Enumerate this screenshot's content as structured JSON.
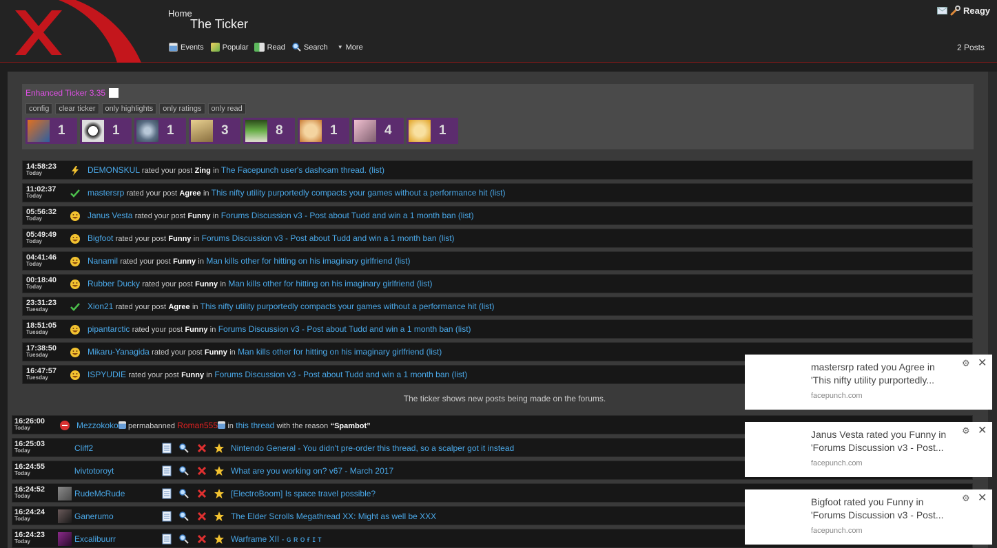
{
  "header": {
    "breadcrumb": "Home",
    "title": "The Ticker",
    "nav": [
      {
        "label": "Events",
        "icon": "calendar-icon"
      },
      {
        "label": "Popular",
        "icon": "popular-icon"
      },
      {
        "label": "Read",
        "icon": "read-icon"
      },
      {
        "label": "Search",
        "icon": "search-icon"
      },
      {
        "label": "More",
        "icon": "chevron-down-icon"
      }
    ],
    "username": "Reagy",
    "posts": "2 Posts"
  },
  "enhanced": {
    "title": "Enhanced Ticker 3.35",
    "buttons": [
      "config",
      "clear ticker",
      "only highlights",
      "only ratings",
      "only read"
    ],
    "avatars": [
      {
        "count": "1",
        "color": "#2f5fa0"
      },
      {
        "count": "1",
        "color": "#ddd"
      },
      {
        "count": "1",
        "color": "#7f93a8"
      },
      {
        "count": "3",
        "color": "#c9a860"
      },
      {
        "count": "8",
        "color": "#4c8a3a"
      },
      {
        "count": "1",
        "color": "#e0b060"
      },
      {
        "count": "4",
        "color": "#c08aa0"
      },
      {
        "count": "1",
        "color": "#e6b040"
      }
    ]
  },
  "ratings": [
    {
      "time": "14:58:23",
      "day": "Today",
      "icon": "zing",
      "user": "DEMONSKUL",
      "mid": "rated your post",
      "rating": "Zing",
      "in": "in",
      "thread": "The Facepunch user's dashcam thread.",
      "list": "(list)"
    },
    {
      "time": "11:02:37",
      "day": "Today",
      "icon": "agree",
      "user": "mastersrp",
      "mid": "rated your post",
      "rating": "Agree",
      "in": "in",
      "thread": "This nifty utility purportedly compacts your games without a performance hit",
      "list": "(list)"
    },
    {
      "time": "05:56:32",
      "day": "Today",
      "icon": "funny",
      "user": "Janus Vesta",
      "mid": "rated your post",
      "rating": "Funny",
      "in": "in",
      "thread": "Forums Discussion v3 - Post about Tudd and win a 1 month ban",
      "list": "(list)"
    },
    {
      "time": "05:49:49",
      "day": "Today",
      "icon": "funny",
      "user": "Bigfoot",
      "mid": "rated your post",
      "rating": "Funny",
      "in": "in",
      "thread": "Forums Discussion v3 - Post about Tudd and win a 1 month ban",
      "list": "(list)"
    },
    {
      "time": "04:41:46",
      "day": "Today",
      "icon": "funny",
      "user": "Nanamil",
      "mid": "rated your post",
      "rating": "Funny",
      "in": "in",
      "thread": "Man kills other for hitting on his imaginary girlfriend",
      "list": "(list)"
    },
    {
      "time": "00:18:40",
      "day": "Today",
      "icon": "funny",
      "user": "Rubber Ducky",
      "mid": "rated your post",
      "rating": "Funny",
      "in": "in",
      "thread": "Man kills other for hitting on his imaginary girlfriend",
      "list": "(list)"
    },
    {
      "time": "23:31:23",
      "day": "Tuesday",
      "icon": "agree",
      "user": "Xion21",
      "mid": "rated your post",
      "rating": "Agree",
      "in": "in",
      "thread": "This nifty utility purportedly compacts your games without a performance hit",
      "list": "(list)"
    },
    {
      "time": "18:51:05",
      "day": "Tuesday",
      "icon": "funny",
      "user": "pipantarctic",
      "mid": "rated your post",
      "rating": "Funny",
      "in": "in",
      "thread": "Forums Discussion v3 - Post about Tudd and win a 1 month ban",
      "list": "(list)"
    },
    {
      "time": "17:38:50",
      "day": "Tuesday",
      "icon": "funny",
      "user": "Mikaru-Yanagida",
      "mid": "rated your post",
      "rating": "Funny",
      "in": "in",
      "thread": "Man kills other for hitting on his imaginary girlfriend",
      "list": "(list)"
    },
    {
      "time": "16:47:57",
      "day": "Tuesday",
      "icon": "funny",
      "user": "ISPYUDIE",
      "mid": "rated your post",
      "rating": "Funny",
      "in": "in",
      "thread": "Forums Discussion v3 - Post about Tudd and win a 1 month ban",
      "list": "(list)"
    }
  ],
  "footer_note": "The ticker shows new posts being made on the forums.",
  "ban": {
    "time": "16:26:00",
    "day": "Today",
    "mod": "Mezzokoko",
    "action": "permabanned",
    "user": "Roman555",
    "in": "in",
    "link": "this thread",
    "reason_label": "with the reason",
    "reason": "“Spambot”"
  },
  "threads": [
    {
      "time": "16:25:03",
      "day": "Today",
      "user": "Cliff2",
      "avatar": "",
      "title": "Nintendo General - You didn't pre-order this thread, so a scalper got it instead"
    },
    {
      "time": "16:24:55",
      "day": "Today",
      "user": "lvivtotoroyt",
      "avatar": "",
      "title": "What are you working on? v67 - March 2017"
    },
    {
      "time": "16:24:52",
      "day": "Today",
      "user": "RudeMcRude",
      "avatar": "#6d6d6d",
      "title": "[ElectroBoom] Is space travel possible?"
    },
    {
      "time": "16:24:24",
      "day": "Today",
      "user": "Ganerumo",
      "avatar": "#4a3a3a",
      "title": "The Elder Scrolls Megathread XX: Might as well be XXX"
    },
    {
      "time": "16:24:23",
      "day": "Today",
      "user": "Excalibuurr",
      "avatar": "#5a1a5a",
      "title": "Warframe XII - ɢ ʀ ᴏ ғ ɪ ᴛ"
    }
  ],
  "notifications": [
    {
      "line1": "mastersrp rated you Agree in",
      "line2": "'This nifty utility purportedly...",
      "source": "facepunch.com"
    },
    {
      "line1": "Janus Vesta rated you Funny in",
      "line2": "'Forums Discussion v3 - Post...",
      "source": "facepunch.com"
    },
    {
      "line1": "Bigfoot rated you Funny in",
      "line2": "'Forums Discussion v3 - Post...",
      "source": "facepunch.com"
    }
  ],
  "colors": {
    "accent_red": "#c4161c",
    "link": "#4aa8e8",
    "ticker_purple": "#5c2c6e",
    "title_pink": "#e050e6"
  }
}
